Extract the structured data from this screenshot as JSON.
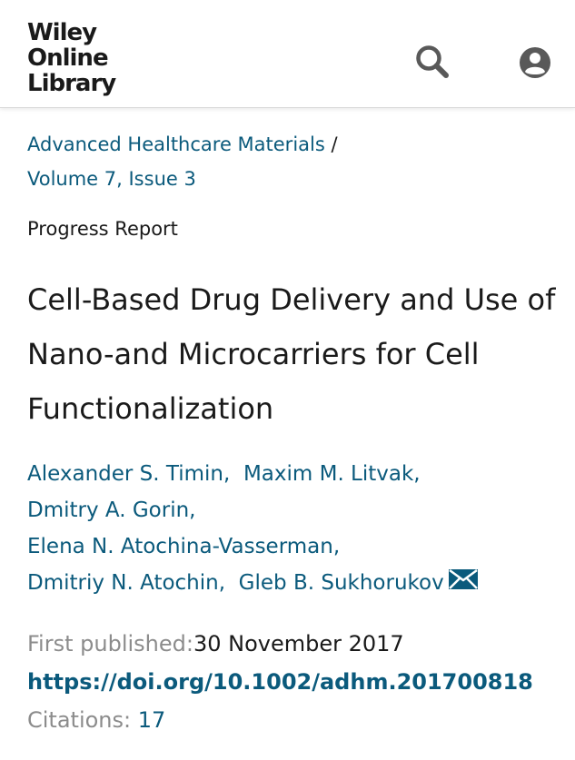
{
  "header": {
    "logo": [
      "Wiley",
      "Online",
      "Library"
    ]
  },
  "breadcrumb": {
    "journal": "Advanced Healthcare Materials",
    "separator": "/",
    "issue": "Volume 7, Issue 3"
  },
  "article": {
    "type": "Progress Report",
    "title": "Cell-Based Drug Delivery and Use of Nano-and Microcarriers for Cell Functionalization",
    "authors": [
      "Alexander S. Timin,",
      "Maxim M. Litvak,",
      "Dmitry A. Gorin,",
      "Elena N. Atochina-Vasserman,",
      "Dmitriy N. Atochin,",
      "Gleb B. Sukhorukov"
    ],
    "first_published_label": "First published:",
    "first_published_date": "30 November 2017",
    "doi": "https://doi.org/10.1002/adhm.201700818",
    "citations_label": "Citations:",
    "citations_count": "17"
  },
  "icons": {
    "search": "search-icon",
    "user": "user-account-icon",
    "mail": "envelope-icon"
  },
  "colors": {
    "link": "#0b5a7c",
    "text": "#1a1a1a",
    "muted": "#8c8c8c"
  }
}
